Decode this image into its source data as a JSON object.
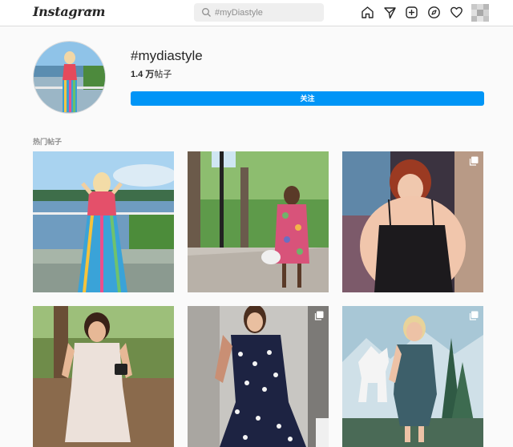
{
  "header": {
    "logo": "Instagram",
    "search_placeholder": "#myDiastyle"
  },
  "nav": {
    "icons": [
      "home-icon",
      "direct-icon",
      "new-post-icon",
      "explore-icon",
      "activity-heart-icon",
      "profile-avatar"
    ]
  },
  "hashtag": {
    "title": "#mydiastyle",
    "count_value": "1.4 万",
    "count_suffix": "帖子",
    "follow_label": "关注"
  },
  "section": {
    "title": "热门帖子"
  },
  "posts": [
    {
      "id": 1,
      "multi": false
    },
    {
      "id": 2,
      "multi": false
    },
    {
      "id": 3,
      "multi": true
    },
    {
      "id": 4,
      "multi": false
    },
    {
      "id": 5,
      "multi": true
    },
    {
      "id": 6,
      "multi": true
    }
  ],
  "colors": {
    "accent": "#0095f6",
    "border": "#dbdbdb",
    "background": "#fafafa"
  }
}
